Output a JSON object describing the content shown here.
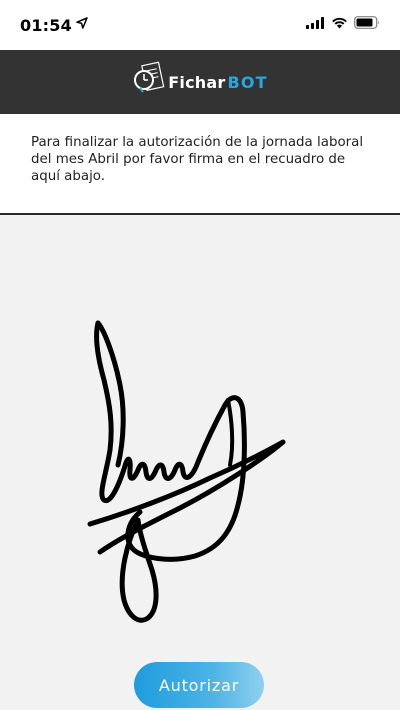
{
  "status_bar": {
    "time": "01:54",
    "location_icon": "location-arrow-icon",
    "signal_icon": "cellular-signal-icon",
    "wifi_icon": "wifi-icon",
    "battery_icon": "battery-icon"
  },
  "header": {
    "logo_text_part1": "Fichar",
    "logo_text_part2": "BOT",
    "logo_icon": "clock-document-icon",
    "background_color": "#333333",
    "accent_color": "#29a6e0"
  },
  "instructions": {
    "text": "Para finalizar la autorización de la jornada laboral del mes Abril por favor firma en el recuadro de aquí abajo."
  },
  "signature": {
    "stroke_color": "#000000"
  },
  "actions": {
    "authorize_label": "Autorizar"
  }
}
